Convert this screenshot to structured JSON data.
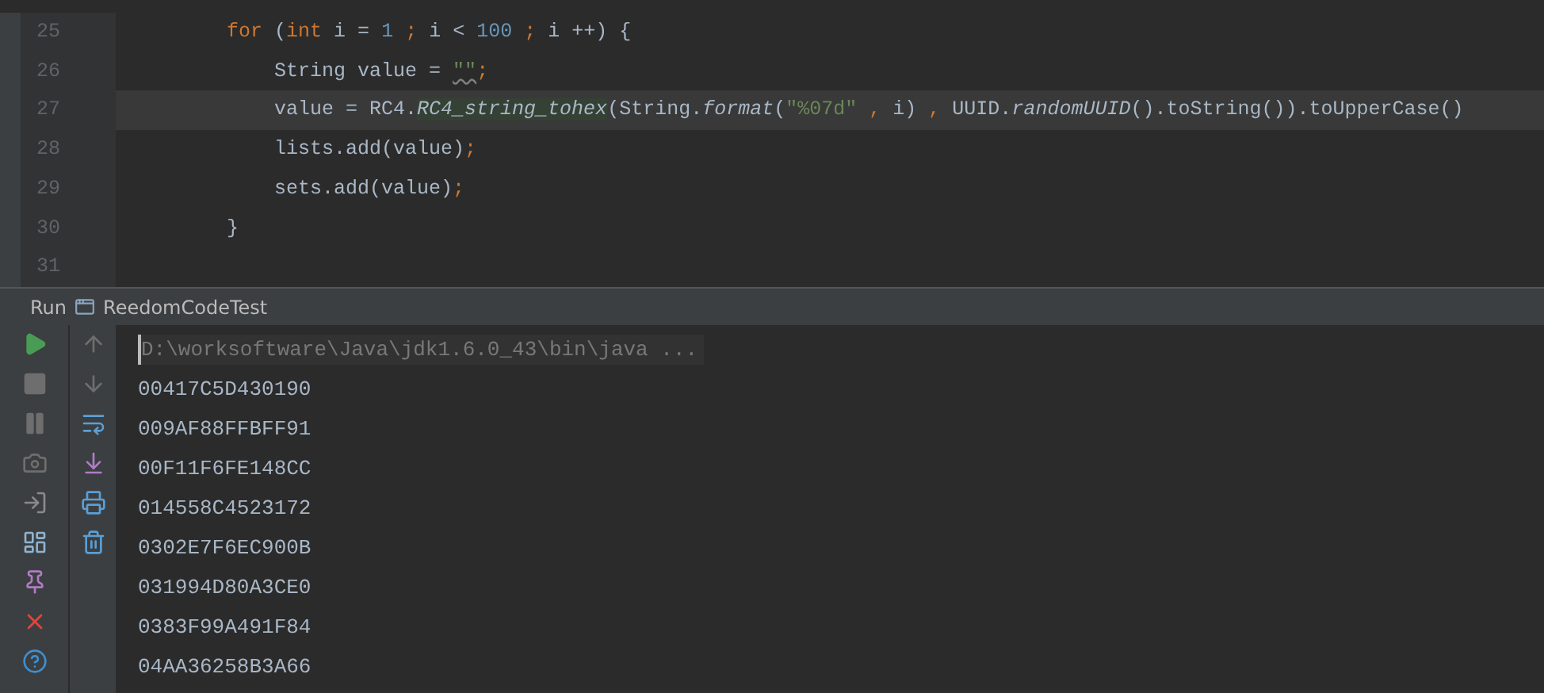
{
  "editor": {
    "lines": [
      {
        "number": "25",
        "current": false,
        "tokens": [
          {
            "text": "        for",
            "kind": "keyword"
          },
          {
            "text": " (",
            "kind": "plain"
          },
          {
            "text": "int",
            "kind": "keyword"
          },
          {
            "text": " i = ",
            "kind": "plain"
          },
          {
            "text": "1",
            "kind": "number"
          },
          {
            "text": " ; ",
            "kind": "punct"
          },
          {
            "text": "i < ",
            "kind": "plain"
          },
          {
            "text": "100",
            "kind": "number"
          },
          {
            "text": " ; ",
            "kind": "punct"
          },
          {
            "text": "i ++) {",
            "kind": "plain"
          }
        ]
      },
      {
        "number": "26",
        "current": false,
        "tokens": [
          {
            "text": "            String value = ",
            "kind": "plain"
          },
          {
            "text": "\"\"",
            "kind": "warn"
          },
          {
            "text": ";",
            "kind": "punct"
          }
        ]
      },
      {
        "number": "27",
        "current": true,
        "tokens": [
          {
            "text": "            value = RC4.",
            "kind": "plain"
          },
          {
            "text": "RC4_string_tohex",
            "kind": "highlight"
          },
          {
            "text": "(String.",
            "kind": "plain"
          },
          {
            "text": "format",
            "kind": "static"
          },
          {
            "text": "(",
            "kind": "plain"
          },
          {
            "text": "\"%07d\"",
            "kind": "string"
          },
          {
            "text": " , ",
            "kind": "punct"
          },
          {
            "text": "i) ",
            "kind": "plain"
          },
          {
            "text": ", ",
            "kind": "punct"
          },
          {
            "text": "UUID.",
            "kind": "plain"
          },
          {
            "text": "randomUUID",
            "kind": "static"
          },
          {
            "text": "().toString()).toUpperCase()",
            "kind": "plain"
          }
        ]
      },
      {
        "number": "28",
        "current": false,
        "tokens": [
          {
            "text": "            lists.add(value)",
            "kind": "plain"
          },
          {
            "text": ";",
            "kind": "punct"
          }
        ]
      },
      {
        "number": "29",
        "current": false,
        "tokens": [
          {
            "text": "            sets.add(value)",
            "kind": "plain"
          },
          {
            "text": ";",
            "kind": "punct"
          }
        ]
      },
      {
        "number": "30",
        "current": false,
        "tokens": [
          {
            "text": "        }",
            "kind": "plain"
          }
        ]
      },
      {
        "number": "31",
        "current": false
      }
    ]
  },
  "run_panel": {
    "label": "Run",
    "config": "ReedomCodeTest",
    "command": "D:\\worksoftware\\Java\\jdk1.6.0_43\\bin\\java ...",
    "output": [
      "00417C5D430190",
      "009AF88FFBFF91",
      "00F11F6FE148CC",
      "014558C4523172",
      "0302E7F6EC900B",
      "031994D80A3CE0",
      "0383F99A491F84",
      "04AA36258B3A66"
    ]
  }
}
